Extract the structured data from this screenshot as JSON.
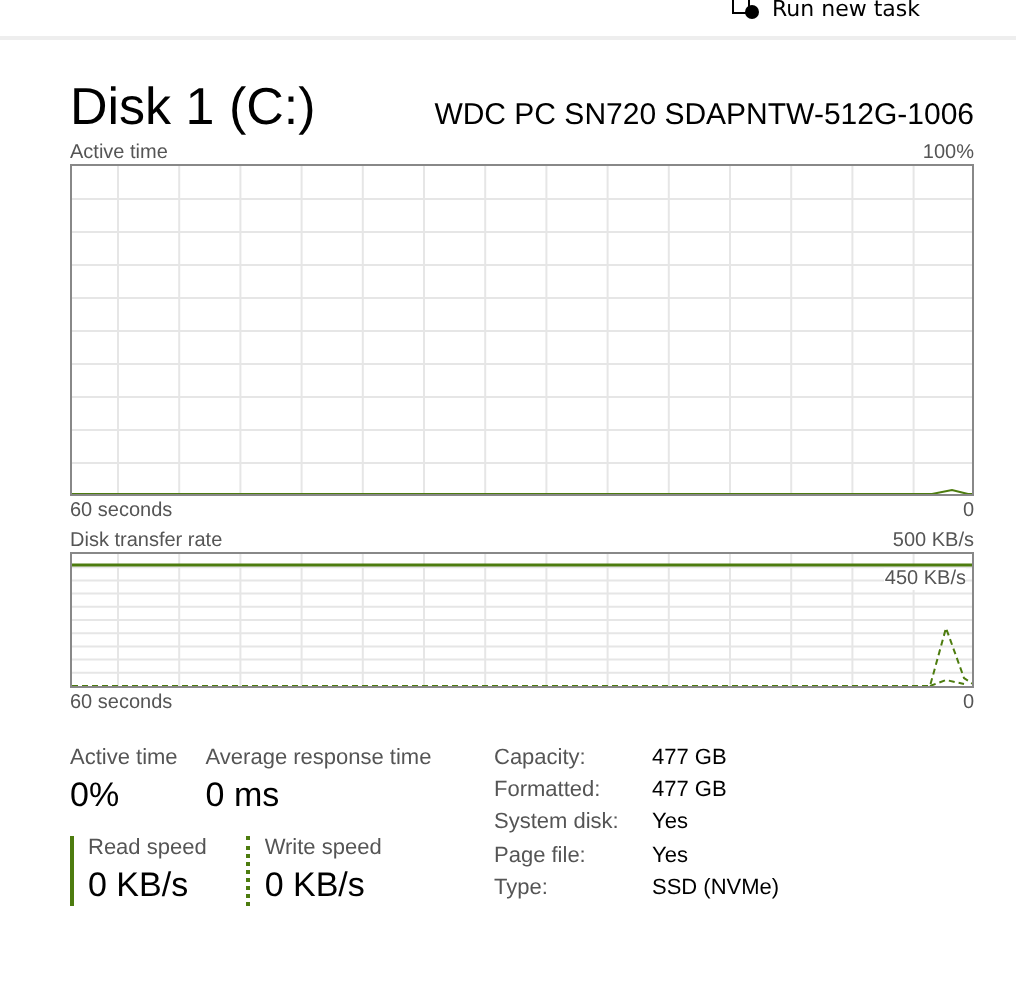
{
  "toolbar": {
    "run_task": "Run new task"
  },
  "header": {
    "title": "Disk 1 (C:)",
    "model": "WDC PC SN720 SDAPNTW-512G-1006"
  },
  "graphs": [
    {
      "label": "Active time",
      "max": "100%",
      "duration": "60 seconds",
      "min": "0",
      "kind": "active"
    },
    {
      "label": "Disk transfer rate",
      "max": "500 KB/s",
      "duration": "60 seconds",
      "min": "0",
      "kind": "transfer",
      "inner_label": "450 KB/s"
    }
  ],
  "stats": [
    {
      "label": "Active time",
      "value": "0%"
    },
    {
      "label": "Average response time",
      "value": "0 ms"
    }
  ],
  "speeds": [
    {
      "label": "Read speed",
      "value": "0 KB/s",
      "kind": "solid"
    },
    {
      "label": "Write speed",
      "value": "0 KB/s",
      "kind": "dotted"
    }
  ],
  "properties": [
    {
      "label": "Capacity:",
      "value": "477 GB"
    },
    {
      "label": "Formatted:",
      "value": "477 GB"
    },
    {
      "label": "System disk:",
      "value": "Yes"
    },
    {
      "label": "Page file:",
      "value": "Yes"
    },
    {
      "label": "Type:",
      "value": "SSD (NVMe)"
    }
  ]
}
